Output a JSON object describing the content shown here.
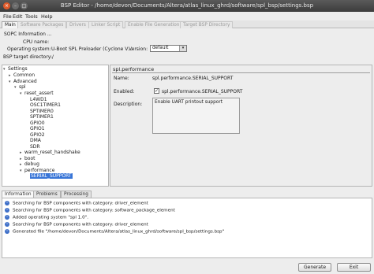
{
  "window": {
    "title": "BSP Editor - /home/devon/Documents/Altera/atlas_linux_ghrd/software/spl_bsp/settings.bsp",
    "buttons": [
      "×",
      "–",
      "□"
    ]
  },
  "menu": [
    "File",
    "Edit",
    "Tools",
    "Help"
  ],
  "main_tabs": [
    "Main",
    "Software Packages",
    "Drivers",
    "Linker Script",
    "Enable File Generation",
    "Target BSP Directory"
  ],
  "info": {
    "sopc_label": "SOPC Information ...",
    "cpu_label": "CPU name:",
    "os_label": "Operating system:",
    "os_value": "U-Boot SPL Preloader (Cyclone V...",
    "version_label": "Version:",
    "version_value": "default",
    "target_label": "BSP target directory:",
    "target_value": "./"
  },
  "tree": [
    {
      "label": "Settings",
      "toggle": "▾"
    },
    {
      "label": "Common",
      "toggle": "▸"
    },
    {
      "label": "Advanced",
      "toggle": "▾"
    },
    {
      "label": "spl",
      "toggle": "▾"
    },
    {
      "label": "reset_assert",
      "toggle": "▾"
    },
    {
      "label": "L4WD1",
      "toggle": ""
    },
    {
      "label": "OSC1TIMER1",
      "toggle": ""
    },
    {
      "label": "SPTIMER0",
      "toggle": ""
    },
    {
      "label": "SPTIMER1",
      "toggle": ""
    },
    {
      "label": "GPIO0",
      "toggle": ""
    },
    {
      "label": "GPIO1",
      "toggle": ""
    },
    {
      "label": "GPIO2",
      "toggle": ""
    },
    {
      "label": "DMA",
      "toggle": ""
    },
    {
      "label": "SDR",
      "toggle": ""
    },
    {
      "label": "warm_reset_handshake",
      "toggle": "▸"
    },
    {
      "label": "boot",
      "toggle": "▸"
    },
    {
      "label": "debug",
      "toggle": "▸"
    },
    {
      "label": "performance",
      "toggle": "▾"
    },
    {
      "label": "SERIAL_SUPPORT",
      "toggle": ""
    }
  ],
  "details": {
    "heading": "spl.performance",
    "name_label": "Name:",
    "name_value": "spl.performance.SERIAL_SUPPORT",
    "enabled_label": "Enabled:",
    "enabled_checked": "✓",
    "enabled_value": "spl.performance.SERIAL_SUPPORT",
    "description_label": "Description:",
    "description_value": "Enable UART printout support"
  },
  "bottom_tabs": [
    "Information",
    "Problems",
    "Processing"
  ],
  "log": [
    "Searching for BSP components with category: driver_element",
    "Searching for BSP components with category: software_package_element",
    "Added operating system \"spl 1.0\".",
    "Searching for BSP components with category: driver_element",
    "Generated file \"/home/devon/Documents/Altera/atlas_linux_ghrd/software/spl_bsp/settings.bsp\""
  ],
  "footer": {
    "generate": "Generate",
    "exit": "Exit"
  },
  "colors": {
    "selection": "#3875d7",
    "info_icon": "#3e6fc8",
    "titlebar": "#3c3c3c"
  }
}
